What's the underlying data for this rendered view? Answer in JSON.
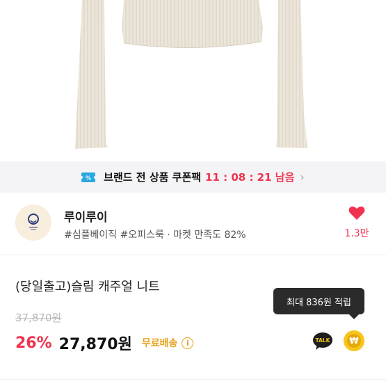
{
  "coupon_banner": {
    "label": "브랜드 전 상품 쿠폰팩",
    "timer": "11 : 08 : 21",
    "timer_suffix": "남음",
    "accent_color": "#f0324f"
  },
  "shop": {
    "name": "루이루이",
    "tags": "#심플베이직 #오피스룩 · 마켓 만족도 82%",
    "like_count": "1.3만"
  },
  "product": {
    "title": "(당일출고)슬림 캐주얼 니트",
    "original_price": "37,870원",
    "discount": "26%",
    "price": "27,870원",
    "shipping": "무료배송"
  },
  "tooltip": {
    "text": "최대 836원 적립"
  },
  "actions": {
    "talk_label": "TALK",
    "won_symbol": "₩",
    "info_symbol": "i"
  }
}
